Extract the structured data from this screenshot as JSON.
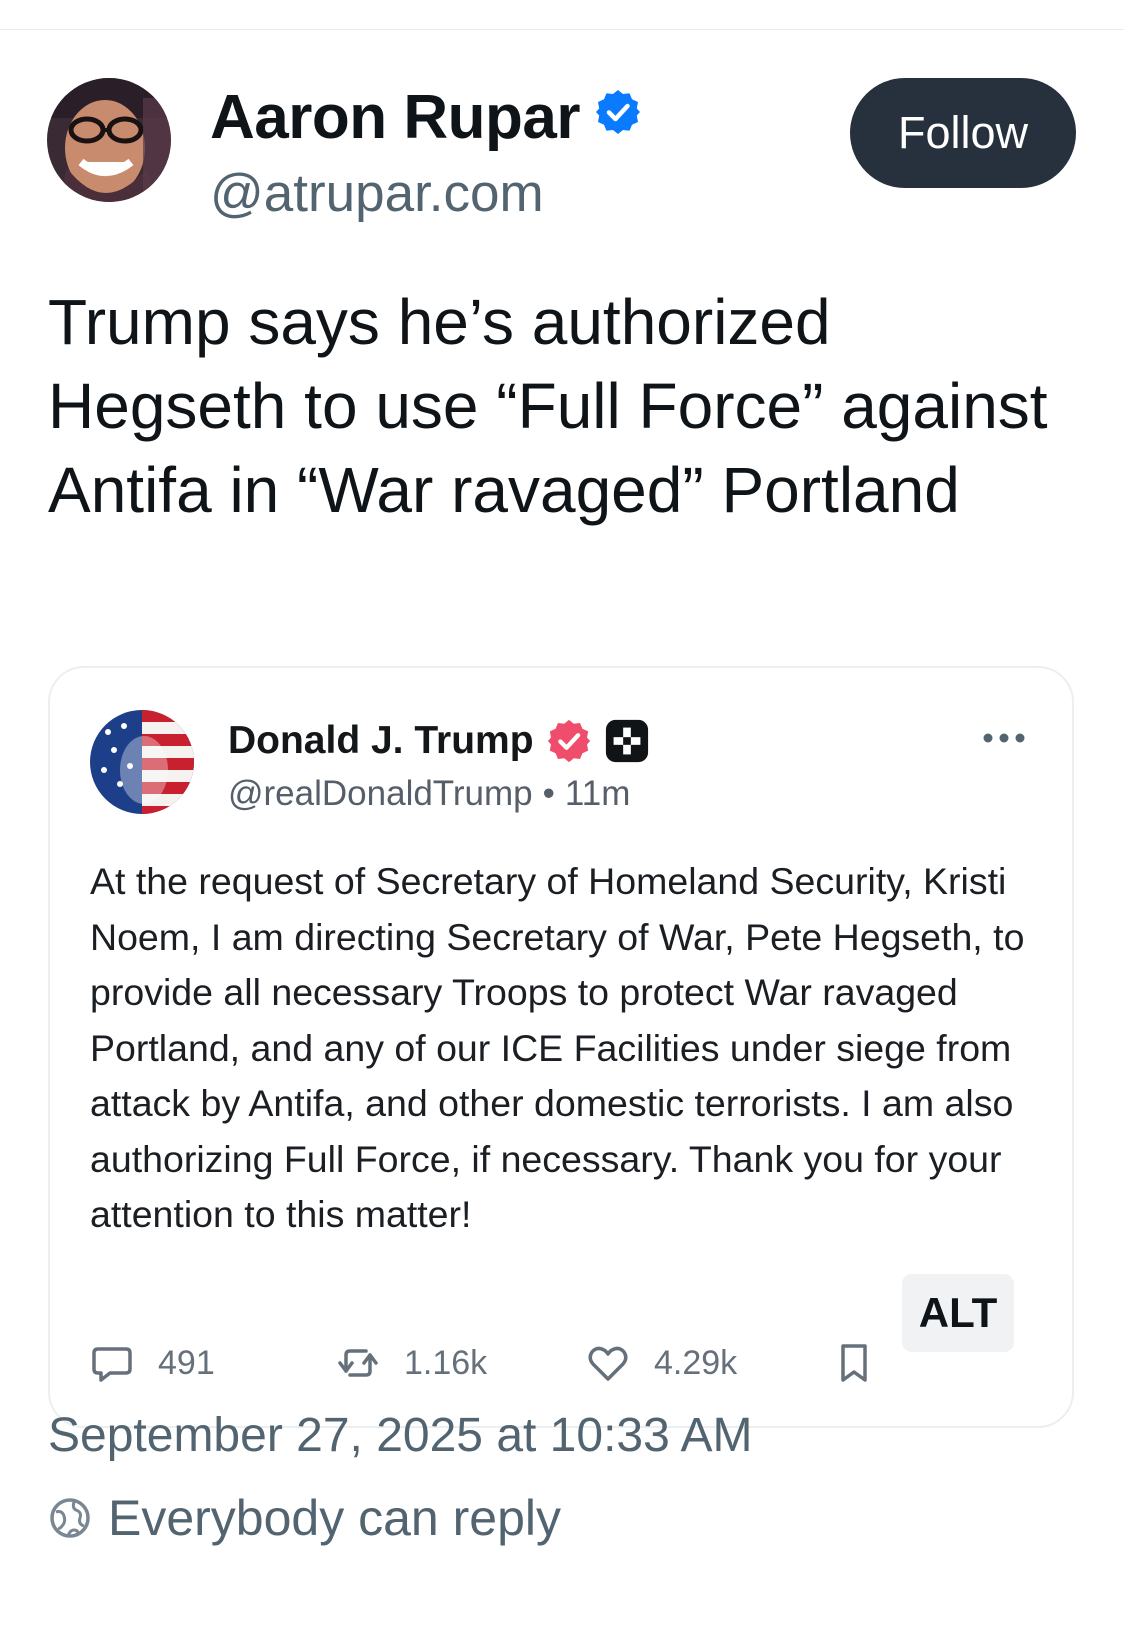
{
  "author": {
    "name": "Aaron Rupar",
    "handle": "@atrupar.com",
    "verified_color": "#0a7aff"
  },
  "follow_label": "Follow",
  "post_text": "Trump says he’s authorized Hegseth to use “Full Force” against Antifa in “War ravaged” Portland",
  "quoted": {
    "name": "Donald J. Trump",
    "handle": "@realDonaldTrump",
    "separator": "•",
    "time": "11m",
    "body": "At the request of Secretary of Homeland Security, Kristi Noem, I am directing Secretary of War, Pete Hegseth, to provide all necessary Troops to protect War ravaged Portland, and any of our ICE Facilities under siege from attack by Antifa, and other domestic terrorists. I am also authorizing Full Force, if necessary. Thank you for your attention to this matter!",
    "actions": {
      "replies": "491",
      "reposts": "1.16k",
      "likes": "4.29k"
    },
    "badge_color": "#ef4d6b"
  },
  "alt_label": "ALT",
  "timestamp": "September 27, 2025 at 10:33 AM",
  "reply_setting": "Everybody can reply"
}
